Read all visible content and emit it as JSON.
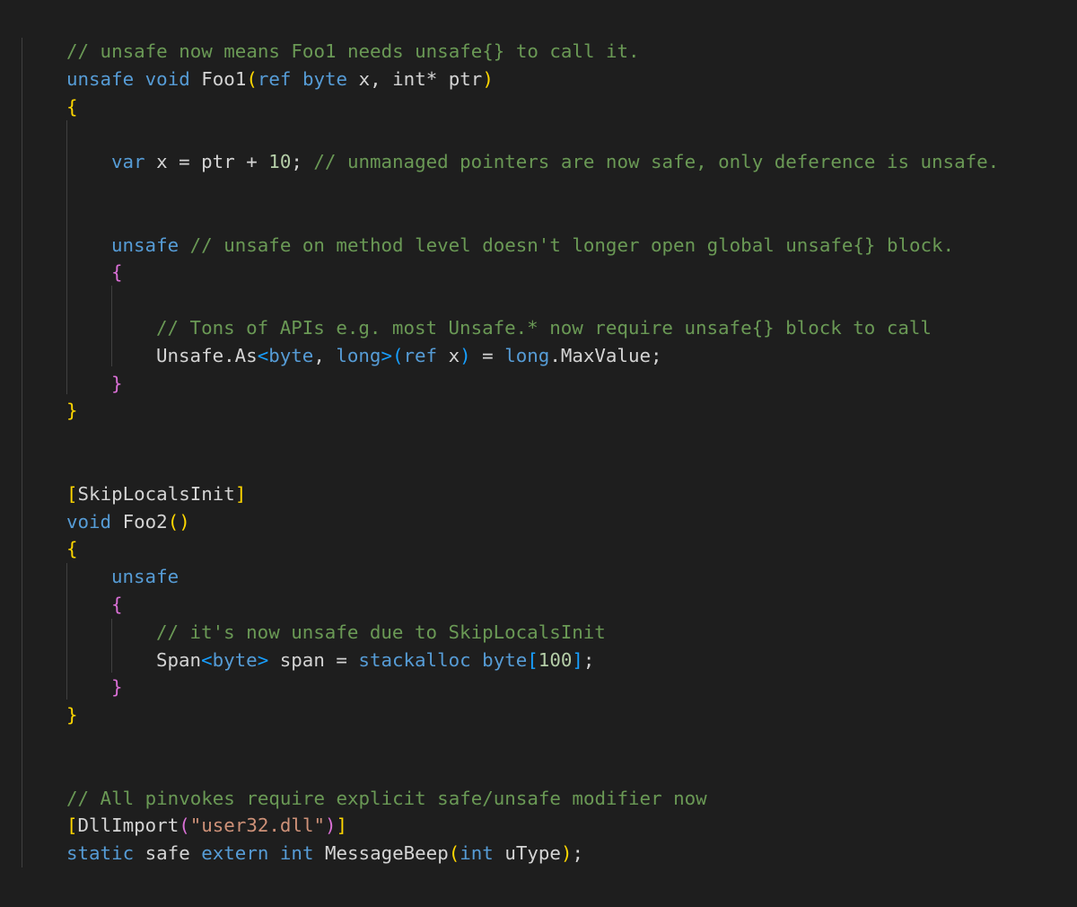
{
  "editor": {
    "colors": {
      "background": "#1e1e1e",
      "keyword": "#569cd6",
      "comment": "#6a9955",
      "text": "#d4d4d4",
      "number": "#b5cea8",
      "string": "#ce9178",
      "bracket_level_1": "#ffd700",
      "bracket_level_2": "#da70d6",
      "bracket_level_3": "#179fff",
      "indent_guide": "#404040"
    },
    "lines": [
      {
        "indent": 0,
        "tokens": [
          {
            "t": "// unsafe now means Foo1 needs unsafe{} to call it.",
            "c": "cm"
          }
        ]
      },
      {
        "indent": 0,
        "tokens": [
          {
            "t": "unsafe",
            "c": "kw"
          },
          {
            "t": " ",
            "c": "tx"
          },
          {
            "t": "void",
            "c": "kw"
          },
          {
            "t": " Foo1",
            "c": "tx"
          },
          {
            "t": "(",
            "c": "b1"
          },
          {
            "t": "ref",
            "c": "kw"
          },
          {
            "t": " ",
            "c": "tx"
          },
          {
            "t": "byte",
            "c": "kw"
          },
          {
            "t": " x, int* ptr",
            "c": "tx"
          },
          {
            "t": ")",
            "c": "b1"
          }
        ]
      },
      {
        "indent": 0,
        "tokens": [
          {
            "t": "{",
            "c": "b1"
          }
        ]
      },
      {
        "indent": 0,
        "tokens": []
      },
      {
        "indent": 1,
        "tokens": [
          {
            "t": "var",
            "c": "kw"
          },
          {
            "t": " x = ptr + ",
            "c": "tx"
          },
          {
            "t": "10",
            "c": "num"
          },
          {
            "t": "; ",
            "c": "tx"
          },
          {
            "t": "// unmanaged pointers are now safe, only deference is unsafe.",
            "c": "cm"
          }
        ]
      },
      {
        "indent": 0,
        "tokens": []
      },
      {
        "indent": 0,
        "tokens": []
      },
      {
        "indent": 1,
        "tokens": [
          {
            "t": "unsafe",
            "c": "kw"
          },
          {
            "t": " ",
            "c": "tx"
          },
          {
            "t": "// unsafe on method level doesn't longer open global unsafe{} block.",
            "c": "cm"
          }
        ]
      },
      {
        "indent": 1,
        "tokens": [
          {
            "t": "{",
            "c": "b2"
          }
        ]
      },
      {
        "indent": 0,
        "tokens": []
      },
      {
        "indent": 2,
        "tokens": [
          {
            "t": "// Tons of APIs e.g. most Unsafe.* now require unsafe{} block to call",
            "c": "cm"
          }
        ]
      },
      {
        "indent": 2,
        "tokens": [
          {
            "t": "Unsafe.As",
            "c": "tx"
          },
          {
            "t": "<",
            "c": "b3"
          },
          {
            "t": "byte",
            "c": "kw"
          },
          {
            "t": ", ",
            "c": "tx"
          },
          {
            "t": "long",
            "c": "kw"
          },
          {
            "t": ">",
            "c": "b3"
          },
          {
            "t": "(",
            "c": "b3"
          },
          {
            "t": "ref",
            "c": "kw"
          },
          {
            "t": " x",
            "c": "tx"
          },
          {
            "t": ")",
            "c": "b3"
          },
          {
            "t": " = ",
            "c": "tx"
          },
          {
            "t": "long",
            "c": "kw"
          },
          {
            "t": ".MaxValue;",
            "c": "tx"
          }
        ]
      },
      {
        "indent": 1,
        "tokens": [
          {
            "t": "}",
            "c": "b2"
          }
        ]
      },
      {
        "indent": 0,
        "tokens": [
          {
            "t": "}",
            "c": "b1"
          }
        ]
      },
      {
        "indent": 0,
        "tokens": []
      },
      {
        "indent": 0,
        "tokens": []
      },
      {
        "indent": 0,
        "tokens": [
          {
            "t": "[",
            "c": "b1"
          },
          {
            "t": "SkipLocalsInit",
            "c": "tx"
          },
          {
            "t": "]",
            "c": "b1"
          }
        ]
      },
      {
        "indent": 0,
        "tokens": [
          {
            "t": "void",
            "c": "kw"
          },
          {
            "t": " Foo2",
            "c": "tx"
          },
          {
            "t": "()",
            "c": "b1"
          }
        ]
      },
      {
        "indent": 0,
        "tokens": [
          {
            "t": "{",
            "c": "b1"
          }
        ]
      },
      {
        "indent": 1,
        "tokens": [
          {
            "t": "unsafe",
            "c": "kw"
          }
        ]
      },
      {
        "indent": 1,
        "tokens": [
          {
            "t": "{",
            "c": "b2"
          }
        ]
      },
      {
        "indent": 2,
        "tokens": [
          {
            "t": "// it's now unsafe due to SkipLocalsInit",
            "c": "cm"
          }
        ]
      },
      {
        "indent": 2,
        "tokens": [
          {
            "t": "Span",
            "c": "tx"
          },
          {
            "t": "<",
            "c": "b3"
          },
          {
            "t": "byte",
            "c": "kw"
          },
          {
            "t": ">",
            "c": "b3"
          },
          {
            "t": " span = ",
            "c": "tx"
          },
          {
            "t": "stackalloc",
            "c": "kw"
          },
          {
            "t": " ",
            "c": "tx"
          },
          {
            "t": "byte",
            "c": "kw"
          },
          {
            "t": "[",
            "c": "b3"
          },
          {
            "t": "100",
            "c": "num"
          },
          {
            "t": "]",
            "c": "b3"
          },
          {
            "t": ";",
            "c": "tx"
          }
        ]
      },
      {
        "indent": 1,
        "tokens": [
          {
            "t": "}",
            "c": "b2"
          }
        ]
      },
      {
        "indent": 0,
        "tokens": [
          {
            "t": "}",
            "c": "b1"
          }
        ]
      },
      {
        "indent": 0,
        "tokens": []
      },
      {
        "indent": 0,
        "tokens": []
      },
      {
        "indent": 0,
        "tokens": [
          {
            "t": "// All pinvokes require explicit safe/unsafe modifier now",
            "c": "cm"
          }
        ]
      },
      {
        "indent": 0,
        "tokens": [
          {
            "t": "[",
            "c": "b1"
          },
          {
            "t": "DllImport",
            "c": "tx"
          },
          {
            "t": "(",
            "c": "b2"
          },
          {
            "t": "\"user32.dll\"",
            "c": "str"
          },
          {
            "t": ")",
            "c": "b2"
          },
          {
            "t": "]",
            "c": "b1"
          }
        ]
      },
      {
        "indent": 0,
        "tokens": [
          {
            "t": "static",
            "c": "kw"
          },
          {
            "t": " safe ",
            "c": "tx"
          },
          {
            "t": "extern",
            "c": "kw"
          },
          {
            "t": " ",
            "c": "tx"
          },
          {
            "t": "int",
            "c": "kw"
          },
          {
            "t": " MessageBeep",
            "c": "tx"
          },
          {
            "t": "(",
            "c": "b1"
          },
          {
            "t": "int",
            "c": "kw"
          },
          {
            "t": " uType",
            "c": "tx"
          },
          {
            "t": ")",
            "c": "b1"
          },
          {
            "t": ";",
            "c": "tx"
          }
        ]
      }
    ]
  }
}
